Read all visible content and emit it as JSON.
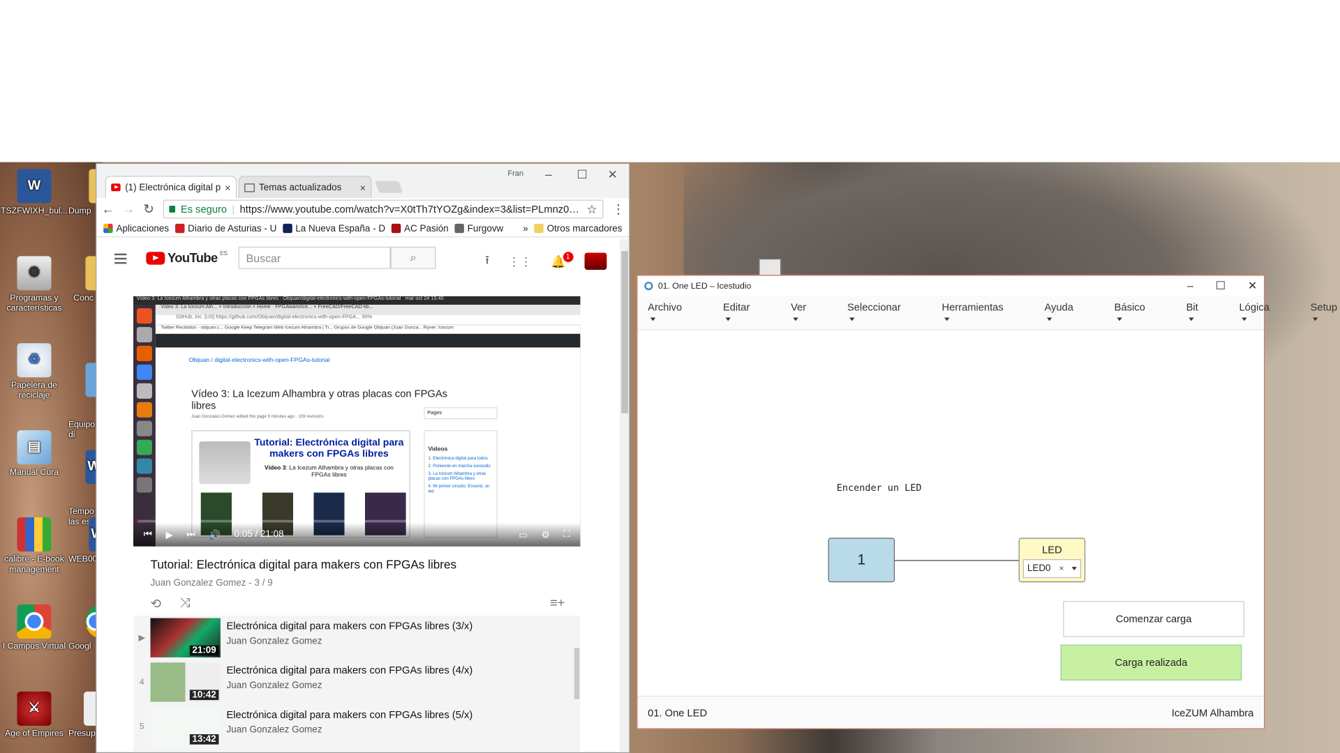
{
  "desktop": {
    "icons": [
      {
        "label": "TSZFWIXH_bul...",
        "icon": "word-doc-icon"
      },
      {
        "label": "Programas y características",
        "icon": "programs-icon"
      },
      {
        "label": "Papelera de reciclaje",
        "icon": "recycle-bin-icon"
      },
      {
        "label": "Manual Cura",
        "icon": "cura-manual-icon"
      },
      {
        "label": "calibre - E-book management",
        "icon": "calibre-icon"
      },
      {
        "label": "I Campus Virtual",
        "icon": "chrome-icon"
      },
      {
        "label": "Age of Empires",
        "icon": "age-of-empires-icon"
      }
    ],
    "partial_icons": [
      "Dump",
      "Conc",
      "Equipo\ndi",
      "Tempo\nlas esta",
      "WEB00",
      "Googl",
      "Presup"
    ]
  },
  "chrome": {
    "user": "Fran",
    "tabs": [
      {
        "label": "(1) Electrónica digital pa",
        "close": "×"
      },
      {
        "label": "Temas actualizados",
        "close": "×"
      }
    ],
    "secure_label": "Es seguro",
    "url": "https://www.youtube.com/watch?v=X0tTh7tYOZg&index=3&list=PLmnz0JqIME...",
    "bookmarks": [
      "Aplicaciones",
      "Diario de Asturias - U",
      "La Nueva España - D",
      "AC Pasión",
      "Furgovw"
    ],
    "more": "»",
    "other_bookmarks": "Otros marcadores"
  },
  "youtube": {
    "logo": "YouTube",
    "logo_region": "ES",
    "search_placeholder": "Buscar",
    "notification_count": "1",
    "player": {
      "inner_window_title": "Vídeo 3: La Icezum Alhambra y otras placas con FPGAs libres · Obijuan/digital-electronics-with-open-FPGAs-tutorial",
      "inner_clock": "mar oct 24 15:40",
      "inner_tabs": "Video 3: La Icezum Alh...  ×  Introducción  ×  Home · FPGAwars/ice...  ×  FreeCAD/FreeCAD-lib...",
      "inner_url": "GitHub, Inc. [US]  https://github.com/Obijuan/digital-electronics-with-open-FPGA...   90%",
      "inner_bookmarks": "Twitter  Recibidos - obijuan.c...  Google Keep  Telegram Web  Icezum Alhambra | Tr...  Grupos de Google  Obijuan (Juan Gonza...  Ryver: Icezum",
      "inner_repo": "Obijuan / digital-electronics-with-open-FPGAs-tutorial",
      "inner_title": "Vídeo 3: La Icezum Alhambra y otras placas con FPGAs libres",
      "inner_meta": "Juan Gonzalez-Gomez edited this page 9 minutes ago · 109 revisions",
      "inner_card_title": "Tutorial: Electrónica digital para makers con FPGAs libres",
      "inner_card_sub_bold": "Vídeo 3",
      "inner_card_sub": ": La Icezum Alhambra y otras placas con FPGAs libres",
      "inner_pages": "Pages",
      "inner_videos": "Videos",
      "inner_links": [
        "1. Electrónica digital para todos",
        "2. Poniendo en marcha icestudio",
        "3. La Icezum Alhambra y otras placas con FPGAs libres",
        "4. Mi primer circuito. Encend. un led"
      ],
      "time": "0:05 / 21:08",
      "progress": 0.004
    },
    "video_title": "Tutorial: Electrónica digital para makers con FPGAs libres",
    "video_sub": "Juan Gonzalez Gomez - 3 / 9",
    "playlist": [
      {
        "index": "▶",
        "title": "Electrónica digital para makers con FPGAs libres (3/x)",
        "author": "Juan Gonzalez Gomez",
        "duration": "21:09"
      },
      {
        "index": "4",
        "title": "Electrónica digital para makers con FPGAs libres (4/x)",
        "author": "Juan Gonzalez Gomez",
        "duration": "10:42"
      },
      {
        "index": "5",
        "title": "Electrónica digital para makers con FPGAs libres (5/x)",
        "author": "Juan Gonzalez Gomez",
        "duration": "13:42"
      }
    ]
  },
  "icestudio": {
    "title": "01. One LED – Icestudio",
    "menu": [
      "Archivo",
      "Editar",
      "Ver",
      "Seleccionar",
      "Herramientas",
      "Ayuda"
    ],
    "menu_right": [
      "Básico",
      "Bit",
      "Lógica",
      "Setup"
    ],
    "comment": "Encender un LED",
    "const_value": "1",
    "led_label": "LED",
    "led_pin": "LED0",
    "upload_button": "Comenzar carga",
    "status_button": "Carga realizada",
    "footer_project": "01. One LED",
    "footer_board": "IceZUM Alhambra"
  }
}
